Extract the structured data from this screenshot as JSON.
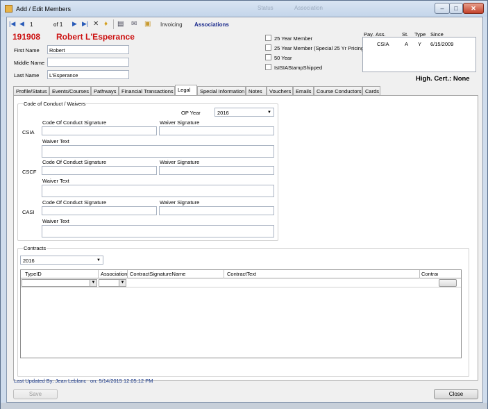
{
  "window": {
    "title": "Add / Edit Members",
    "bg_ghost": [
      "Status",
      "Association"
    ]
  },
  "toolbar": {
    "record": "1",
    "of": "of 1",
    "invoicing": "Invoicing",
    "associations": "Associations"
  },
  "member": {
    "id": "191908",
    "name": "Robert L'Esperance",
    "first_name_label": "First Name",
    "first_name": "Robert",
    "middle_name_label": "Middle Name",
    "middle_name": "",
    "last_name_label": "Last Name",
    "last_name": "L'Esperance"
  },
  "checkboxes": [
    {
      "label": "25 Year Member",
      "checked": false
    },
    {
      "label": "25 Year Member (Special 25 Yr Pricing)",
      "checked": false
    },
    {
      "label": "50 Year",
      "checked": false
    },
    {
      "label": "IsISIAStampShipped",
      "checked": false
    }
  ],
  "assoc_list": {
    "headers": [
      "Pay.",
      "Ass.",
      "St.",
      "Type",
      "Since"
    ],
    "rows": [
      {
        "pay": "",
        "ass": "CSIA",
        "st": "A",
        "type": "Y",
        "since": "6/15/2009"
      }
    ]
  },
  "high_cert": "High. Cert.: None",
  "tabs": [
    "Profile/Status",
    "Events/Courses",
    "Pathways",
    "Financial Transactions",
    "Legal",
    "Special Information",
    "Notes",
    "Vouchers",
    "Emails",
    "Course Conductors",
    "Cards"
  ],
  "active_tab": "Legal",
  "coc": {
    "group_title": "Code of Conduct / Waivers",
    "op_year_label": "OP Year",
    "op_year": "2016",
    "sections": [
      {
        "name": "CSIA",
        "coc_label": "Code Of Conduct Signature",
        "coc_value": "",
        "waiver_label": "Waiver Signature",
        "waiver_value": "",
        "waiver_text_label": "Waiver Text",
        "waiver_text": ""
      },
      {
        "name": "CSCF",
        "coc_label": "Code Of Conduct Signature",
        "coc_value": "",
        "waiver_label": "Waiver Signature",
        "waiver_value": "",
        "waiver_text_label": "Waiver Text",
        "waiver_text": ""
      },
      {
        "name": "CASI",
        "coc_label": "Code Of Conduct Signature",
        "coc_value": "",
        "waiver_label": "Waiver Signature",
        "waiver_value": "",
        "waiver_text_label": "Waiver Text",
        "waiver_text": ""
      }
    ]
  },
  "contracts": {
    "group_title": "Contracts",
    "year": "2016",
    "columns": [
      "TypeID",
      "Association",
      "ContractSignatureName",
      "ContractText",
      "Contract"
    ]
  },
  "footer": {
    "updated_by": "Last Updated By: Jean Leblanc",
    "updated_on": "on: 5/14/2015 12:05:12 PM",
    "save": "Save",
    "close": "Close"
  },
  "colors": {
    "accent_red": "#cc1111",
    "link_blue": "#1a3a8c"
  }
}
